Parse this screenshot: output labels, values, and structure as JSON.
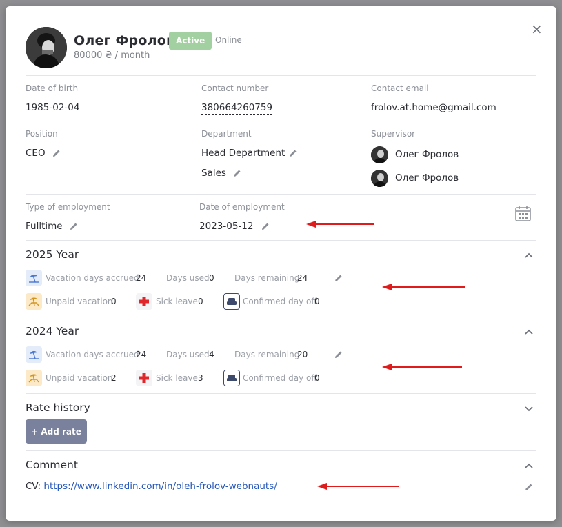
{
  "profile": {
    "name": "Олег Фролов",
    "status_badge": "Active",
    "online_status": "Online",
    "salary": "80000 ₴ / month"
  },
  "info": {
    "dob_label": "Date of birth",
    "dob_value": "1985-02-04",
    "contact_number_label": "Contact number",
    "contact_number_value": "380664260759",
    "contact_email_label": "Contact email",
    "contact_email_value": "frolov.at.home@gmail.com",
    "position_label": "Position",
    "position_value": "CEO",
    "department_label": "Department",
    "departments": [
      "Head Department",
      "Sales"
    ],
    "supervisor_label": "Supervisor",
    "supervisors": [
      "Олег Фролов",
      "Олег Фролов"
    ],
    "type_label": "Type of employment",
    "type_value": "Fulltime",
    "date_employment_label": "Date of employment",
    "date_employment_value": "2023-05-12"
  },
  "years": [
    {
      "title": "2025 Year",
      "accrued_label": "Vacation days accrued",
      "accrued": "24",
      "used_label": "Days used",
      "used": "0",
      "remaining_label": "Days remaining",
      "remaining": "24",
      "unpaid_label": "Unpaid vacation",
      "unpaid": "0",
      "sick_label": "Sick leave",
      "sick": "0",
      "dayoff_label": "Confirmed day off",
      "dayoff": "0"
    },
    {
      "title": "2024 Year",
      "accrued_label": "Vacation days accrued",
      "accrued": "24",
      "used_label": "Days used",
      "used": "4",
      "remaining_label": "Days remaining",
      "remaining": "20",
      "unpaid_label": "Unpaid vacation",
      "unpaid": "2",
      "sick_label": "Sick leave",
      "sick": "3",
      "dayoff_label": "Confirmed day off",
      "dayoff": "0"
    }
  ],
  "rate_history": {
    "title": "Rate history",
    "add_button": "+ Add rate"
  },
  "comment": {
    "title": "Comment",
    "prefix": "CV:",
    "link": "https://www.linkedin.com/in/oleh-frolov-webnauts/"
  },
  "close_symbol": "×",
  "colors": {
    "accent": "#7a819c",
    "active_badge": "#a3d0a0",
    "link": "#2758b9",
    "arrow": "#e01b1b"
  }
}
